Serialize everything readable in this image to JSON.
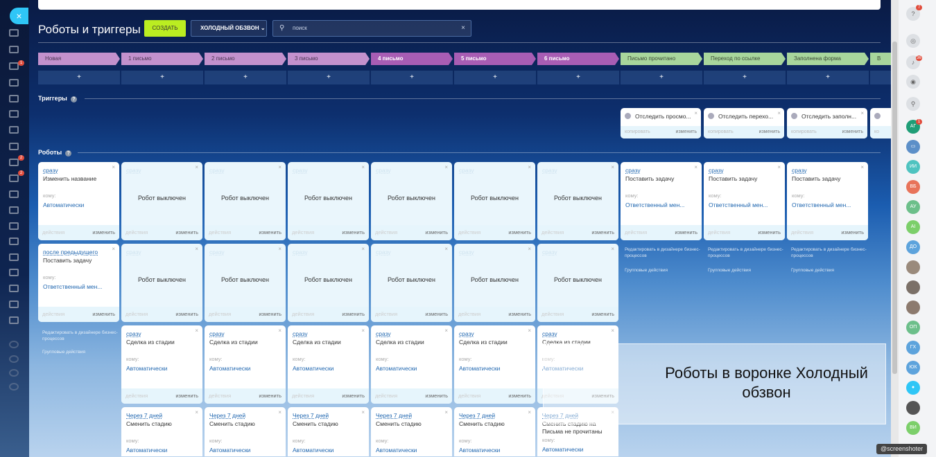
{
  "header": {
    "title": "Роботы и триггеры",
    "create_label": "СОЗДАТЬ",
    "funnel_label": "ХОЛОДНЫЙ ОБЗВОН",
    "search_value": "поиск",
    "close": "×",
    "sidebar_close": "×"
  },
  "stages": [
    {
      "label": "Новая",
      "color": "#c391cd",
      "text": "#4a3552",
      "bold": false
    },
    {
      "label": "1 письмо",
      "color": "#c391cd",
      "text": "#4a3552",
      "bold": false
    },
    {
      "label": "2 письмо",
      "color": "#c391cd",
      "text": "#4a3552",
      "bold": false
    },
    {
      "label": "3 письмо",
      "color": "#c391cd",
      "text": "#4a3552",
      "bold": false
    },
    {
      "label": "4 письмо",
      "color": "#a85db4",
      "text": "#ffffff",
      "bold": true
    },
    {
      "label": "5 письмо",
      "color": "#a85db4",
      "text": "#ffffff",
      "bold": true
    },
    {
      "label": "6 письмо",
      "color": "#a85db4",
      "text": "#ffffff",
      "bold": true
    },
    {
      "label": "Письмо прочитано",
      "color": "#a8d69c",
      "text": "#3b4a36",
      "bold": false
    },
    {
      "label": "Переход по ссылке",
      "color": "#a8d69c",
      "text": "#3b4a36",
      "bold": false
    },
    {
      "label": "Заполнена форма",
      "color": "#a8d69c",
      "text": "#3b4a36",
      "bold": false
    },
    {
      "label": "В",
      "color": "#a8d69c",
      "text": "#3b4a36",
      "bold": false
    }
  ],
  "plus": "+",
  "triggers_label": "Триггеры",
  "robots_label": "Роботы",
  "help": "?",
  "triggers": [
    {
      "col": 7,
      "title": "Отследить просмо...",
      "copy": "копировать",
      "edit": "изменить"
    },
    {
      "col": 8,
      "title": "Отследить перехо...",
      "copy": "копировать",
      "edit": "изменить"
    },
    {
      "col": 9,
      "title": "Отследить заполн...",
      "copy": "копировать",
      "edit": "изменить"
    },
    {
      "col": 10,
      "title": "",
      "copy": "ко",
      "edit": ""
    }
  ],
  "robots": [
    {
      "col": 0,
      "row": 0,
      "delay": "сразу",
      "name": "Изменить название",
      "to_label": "кому:",
      "to": "Автоматически",
      "actions": "действия",
      "edit": "изменить"
    },
    {
      "col": 1,
      "row": 0,
      "off": true,
      "delay": "сразу",
      "off_label": "Робот выключен",
      "actions": "действия",
      "edit": "изменить"
    },
    {
      "col": 2,
      "row": 0,
      "off": true,
      "delay": "сразу",
      "off_label": "Робот выключен",
      "actions": "действия",
      "edit": "изменить"
    },
    {
      "col": 3,
      "row": 0,
      "off": true,
      "delay": "сразу",
      "off_label": "Робот выключен",
      "actions": "действия",
      "edit": "изменить"
    },
    {
      "col": 4,
      "row": 0,
      "off": true,
      "delay": "сразу",
      "off_label": "Робот выключен",
      "actions": "действия",
      "edit": "изменить"
    },
    {
      "col": 5,
      "row": 0,
      "off": true,
      "delay": "сразу",
      "off_label": "Робот выключен",
      "actions": "действия",
      "edit": "изменить"
    },
    {
      "col": 6,
      "row": 0,
      "off": true,
      "delay": "сразу",
      "off_label": "Робот выключен",
      "actions": "действия",
      "edit": "изменить"
    },
    {
      "col": 7,
      "row": 0,
      "delay": "сразу",
      "name": "Поставить задачу",
      "to_label": "кому:",
      "to": "Ответственный мен...",
      "actions": "действия",
      "edit": "изменить"
    },
    {
      "col": 8,
      "row": 0,
      "delay": "сразу",
      "name": "Поставить задачу",
      "to_label": "кому:",
      "to": "Ответственный мен...",
      "actions": "действия",
      "edit": "изменить"
    },
    {
      "col": 9,
      "row": 0,
      "delay": "сразу",
      "name": "Поставить задачу",
      "to_label": "кому:",
      "to": "Ответственный мен...",
      "actions": "действия",
      "edit": "изменить"
    },
    {
      "col": 0,
      "row": 1,
      "delay": "после предыдущего",
      "name": "Поставить задачу",
      "to_label": "кому:",
      "to": "Ответственный мен...",
      "actions": "действия",
      "edit": "изменить"
    },
    {
      "col": 1,
      "row": 1,
      "off": true,
      "delay": "сразу",
      "off_label": "Робот выключен",
      "actions": "действия",
      "edit": "изменить"
    },
    {
      "col": 2,
      "row": 1,
      "off": true,
      "delay": "сразу",
      "off_label": "Робот выключен",
      "actions": "действия",
      "edit": "изменить"
    },
    {
      "col": 3,
      "row": 1,
      "off": true,
      "delay": "сразу",
      "off_label": "Робот выключен",
      "actions": "действия",
      "edit": "изменить"
    },
    {
      "col": 4,
      "row": 1,
      "off": true,
      "delay": "сразу",
      "off_label": "Робот выключен",
      "actions": "действия",
      "edit": "изменить"
    },
    {
      "col": 5,
      "row": 1,
      "off": true,
      "delay": "сразу",
      "off_label": "Робот выключен",
      "actions": "действия",
      "edit": "изменить"
    },
    {
      "col": 6,
      "row": 1,
      "off": true,
      "delay": "сразу",
      "off_label": "Робот выключен",
      "actions": "действия",
      "edit": "изменить"
    },
    {
      "col": 1,
      "row": 2,
      "delay": "сразу",
      "name": "Сделка из стадии",
      "to_label": "кому:",
      "to": "Автоматически",
      "actions": "действия",
      "edit": "изменить"
    },
    {
      "col": 2,
      "row": 2,
      "delay": "сразу",
      "name": "Сделка из стадии",
      "to_label": "кому:",
      "to": "Автоматически",
      "actions": "действия",
      "edit": "изменить"
    },
    {
      "col": 3,
      "row": 2,
      "delay": "сразу",
      "name": "Сделка из стадии",
      "to_label": "кому:",
      "to": "Автоматически",
      "actions": "действия",
      "edit": "изменить"
    },
    {
      "col": 4,
      "row": 2,
      "delay": "сразу",
      "name": "Сделка из стадии",
      "to_label": "кому:",
      "to": "Автоматически",
      "actions": "действия",
      "edit": "изменить"
    },
    {
      "col": 5,
      "row": 2,
      "delay": "сразу",
      "name": "Сделка из стадии",
      "to_label": "кому:",
      "to": "Автоматически",
      "actions": "действия",
      "edit": "изменить"
    },
    {
      "col": 6,
      "row": 2,
      "delay": "сразу",
      "name": "Сделка из стадии",
      "to_label": "кому:",
      "to": "Автоматически",
      "actions": "действия",
      "edit": "изменить"
    },
    {
      "col": 1,
      "row": 3,
      "delay": "Через 7 дней",
      "name": "Сменить стадию",
      "to_label": "кому:",
      "to": "Автоматически"
    },
    {
      "col": 2,
      "row": 3,
      "delay": "Через 7 дней",
      "name": "Сменить стадию",
      "to_label": "кому:",
      "to": "Автоматически"
    },
    {
      "col": 3,
      "row": 3,
      "delay": "Через 7 дней",
      "name": "Сменить стадию",
      "to_label": "кому:",
      "to": "Автоматически"
    },
    {
      "col": 4,
      "row": 3,
      "delay": "Через 7 дней",
      "name": "Сменить стадию",
      "to_label": "кому:",
      "to": "Автоматически"
    },
    {
      "col": 5,
      "row": 3,
      "delay": "Через 7 дней",
      "name": "Сменить стадию",
      "to_label": "кому:",
      "to": "Автоматически"
    },
    {
      "col": 6,
      "row": 3,
      "delay": "Через 7 дней",
      "name": "Сменить стадию на Письма не прочитаны",
      "to_label": "кому:",
      "to": "Автоматически"
    }
  ],
  "links": [
    {
      "col": 0,
      "row": 2,
      "designer": "Редактировать в дизайнере бизнес-процессов",
      "group": "Групповые действия"
    },
    {
      "col": 7,
      "row": 1,
      "designer": "Редактировать в дизайнере бизнес-процессов",
      "group": "Групповые действия"
    },
    {
      "col": 8,
      "row": 1,
      "designer": "Редактировать в дизайнере бизнес-процессов",
      "group": "Групповые действия"
    },
    {
      "col": 9,
      "row": 1,
      "designer": "Редактировать в дизайнере бизнес-процессов",
      "group": "Групповые действия"
    }
  ],
  "overlay_text": "Роботы в воронке Холодный обзвон",
  "left_badges": [
    "1",
    "2",
    "2"
  ],
  "right_panel": {
    "help_badge": "7",
    "notif_badge": "36",
    "chat_badge": "1",
    "avatars": [
      {
        "t": "АГ",
        "c": "#1f9e77"
      },
      {
        "t": "▭",
        "c": "#5c8fc8"
      },
      {
        "t": "ИИ",
        "c": "#4ec3c0"
      },
      {
        "t": "ВБ",
        "c": "#e8735a"
      },
      {
        "t": "АУ",
        "c": "#6cbf8a"
      },
      {
        "t": "АI",
        "c": "#7ccf6a"
      },
      {
        "t": "ДО",
        "c": "#5da3dc"
      },
      {
        "t": "",
        "c": "#9a8a7c"
      },
      {
        "t": "",
        "c": "#7b7068"
      },
      {
        "t": "",
        "c": "#8c7a6e"
      },
      {
        "t": "ОП",
        "c": "#6cbf8a"
      },
      {
        "t": "ГХ",
        "c": "#5da3dc"
      },
      {
        "t": "ЮК",
        "c": "#5da3dc"
      },
      {
        "t": "●",
        "c": "#2fc6f6"
      },
      {
        "t": "",
        "c": "#555"
      },
      {
        "t": "ВИ",
        "c": "#7ccf6a"
      }
    ]
  },
  "watermark": "@screenshoter"
}
